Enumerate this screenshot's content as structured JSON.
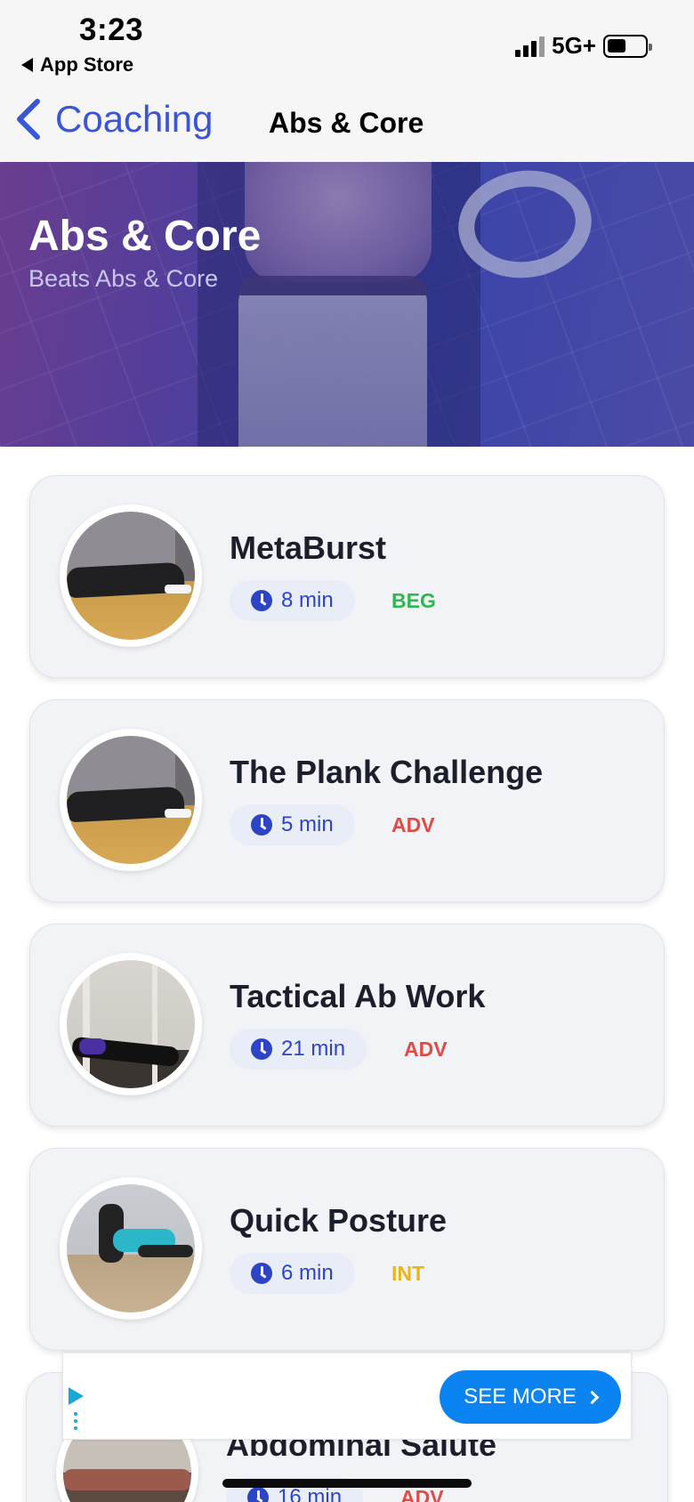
{
  "status_bar": {
    "time": "3:23",
    "back_app": "App Store",
    "network": "5G+",
    "icons": [
      "signal-icon",
      "battery-icon"
    ]
  },
  "nav": {
    "back_label": "Coaching",
    "title": "Abs & Core"
  },
  "hero": {
    "title": "Abs & Core",
    "subtitle": "Beats Abs & Core"
  },
  "workouts": [
    {
      "title": "MetaBurst",
      "duration": "8 min",
      "level": "BEG",
      "level_color": "#2eb84f"
    },
    {
      "title": "The Plank Challenge",
      "duration": "5 min",
      "level": "ADV",
      "level_color": "#e04b45"
    },
    {
      "title": "Tactical Ab Work",
      "duration": "21 min",
      "level": "ADV",
      "level_color": "#e04b45"
    },
    {
      "title": "Quick Posture",
      "duration": "6 min",
      "level": "INT",
      "level_color": "#e8b51b"
    },
    {
      "title": "Abdominal Salute",
      "duration": "16 min",
      "level": "ADV",
      "level_color": "#e04b45"
    }
  ],
  "ad": {
    "cta_label": "SEE MORE"
  },
  "colors": {
    "accent": "#3a56d6",
    "cta": "#0b84f1"
  }
}
